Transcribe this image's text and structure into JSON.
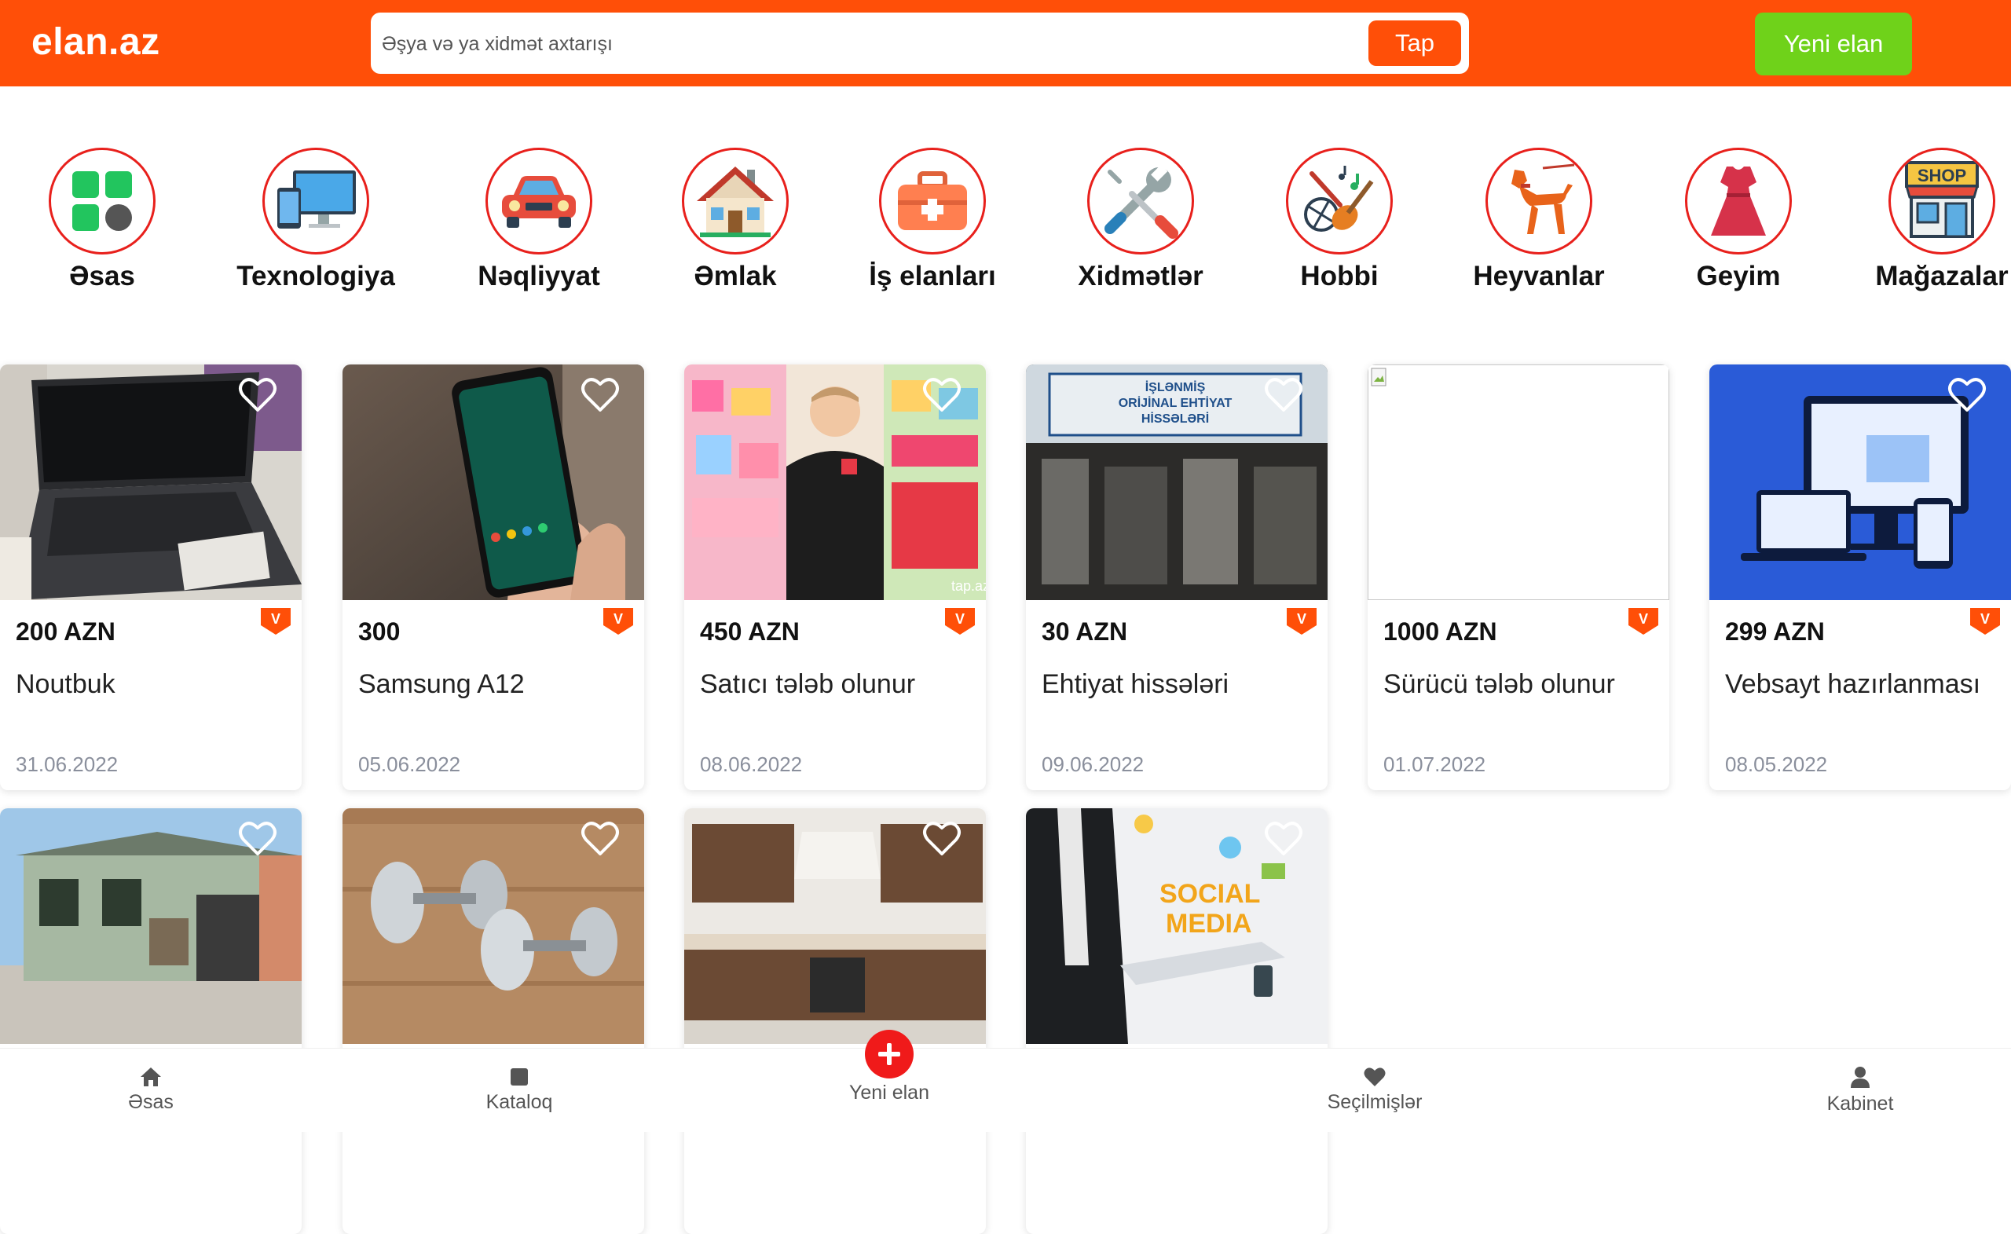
{
  "header": {
    "logo": "elan.az",
    "search_placeholder": "Əşya və ya xidmət axtarışı",
    "search_button": "Tap",
    "new_ad_button": "Yeni elan",
    "brand_color": "#ff4f08",
    "accent_green": "#6fd21a"
  },
  "categories": [
    {
      "label": "Əsas",
      "icon": "grid-icon"
    },
    {
      "label": "Texnologiya",
      "icon": "computer-icon"
    },
    {
      "label": "Nəqliyyat",
      "icon": "car-icon"
    },
    {
      "label": "Əmlak",
      "icon": "house-icon"
    },
    {
      "label": "İş elanları",
      "icon": "briefcase-icon"
    },
    {
      "label": "Xidmətlər",
      "icon": "tools-icon"
    },
    {
      "label": "Hobbi",
      "icon": "hobby-icon"
    },
    {
      "label": "Heyvanlar",
      "icon": "dog-icon"
    },
    {
      "label": "Geyim",
      "icon": "dress-icon"
    },
    {
      "label": "Mağazalar",
      "icon": "shop-icon"
    }
  ],
  "listings": [
    {
      "price": "200 AZN",
      "title": "Noutbuk",
      "date": "31.06.2022",
      "image": "laptop-image"
    },
    {
      "price": "300",
      "title": "Samsung A12",
      "date": "05.06.2022",
      "image": "phone-image"
    },
    {
      "price": "450 AZN",
      "title": "Satıcı tələb olunur",
      "date": "08.06.2022",
      "image": "store-worker-image"
    },
    {
      "price": "30 AZN",
      "title": "Ehtiyat hissələri",
      "date": "09.06.2022",
      "image": "car-parts-shop-image"
    },
    {
      "price": "1000 AZN",
      "title": "Sürücü tələb olunur",
      "date": "01.07.2022",
      "image": "broken-image"
    },
    {
      "price": "299 AZN",
      "title": "Vebsayt hazırlanması",
      "date": "08.05.2022",
      "image": "website-devices-image"
    },
    {
      "price": "",
      "title": "",
      "date": "",
      "image": "house-image"
    },
    {
      "price": "",
      "title": "",
      "date": "",
      "image": "dumbbells-image"
    },
    {
      "price": "",
      "title": "",
      "date": "",
      "image": "kitchen-image"
    },
    {
      "price": "",
      "title": "",
      "date": "",
      "image": "social-media-image"
    }
  ],
  "shop_sign_text": "SHOP",
  "image_texts": {
    "parts_sign_1": "İŞLƏNMİŞ",
    "parts_sign_2": "ORİJİNAL EHTİYAT",
    "parts_sign_3": "HİSSƏLƏRİ",
    "store_watermark": "tap.az",
    "social_1": "SOCIAL",
    "social_2": "MEDIA"
  },
  "bottom_nav": [
    {
      "label": "Əsas",
      "icon": "home-icon"
    },
    {
      "label": "Kataloq",
      "icon": "catalog-icon"
    },
    {
      "label": "Yeni elan",
      "icon": "plus-icon"
    },
    {
      "label": "Seçilmişlər",
      "icon": "heart-icon"
    },
    {
      "label": "Kabinet",
      "icon": "user-icon"
    }
  ]
}
